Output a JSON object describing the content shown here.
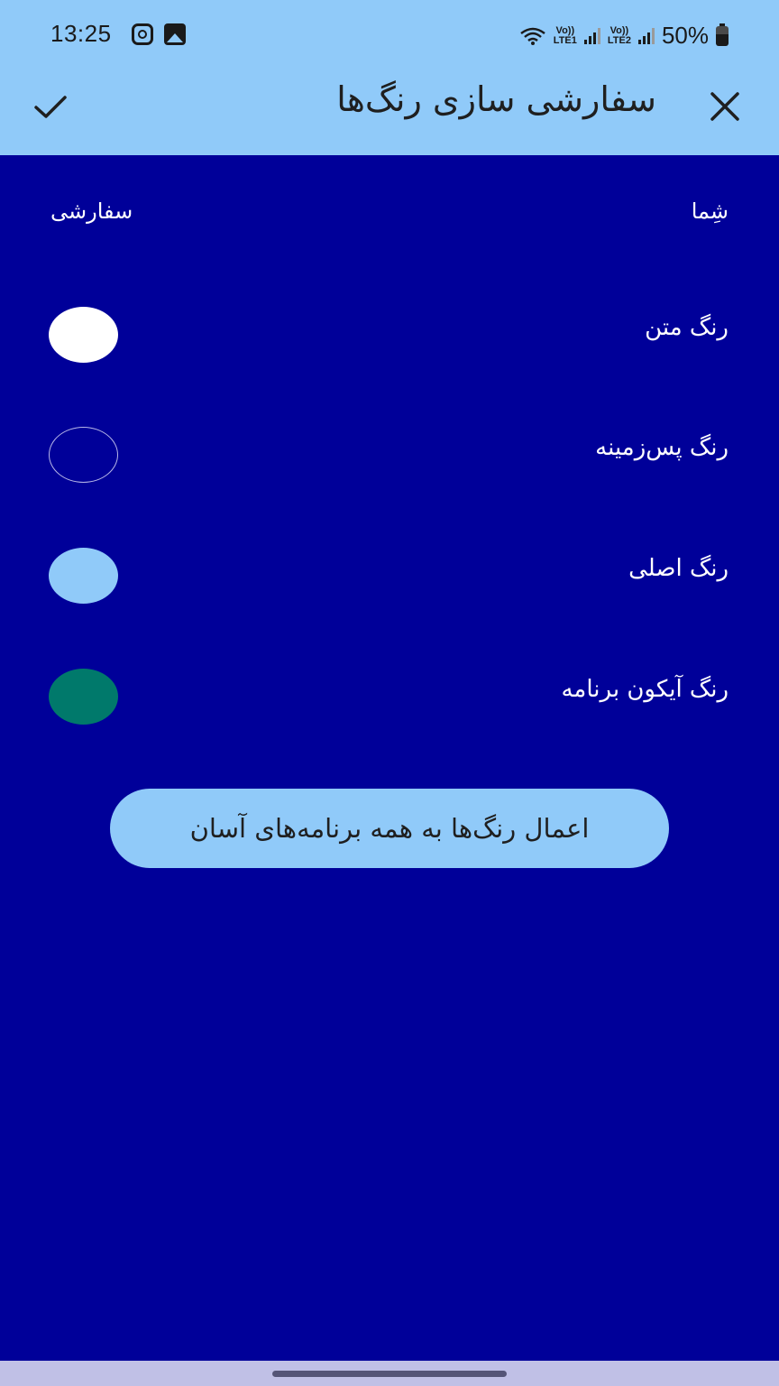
{
  "status_bar": {
    "time": "13:25",
    "left_icons": [
      "instagram-icon",
      "gallery-icon"
    ],
    "sim1_label_top": "Vo))",
    "sim1_label_bottom": "LTE1",
    "sim2_label_top": "Vo))",
    "sim2_label_bottom": "LTE2",
    "battery": "50%"
  },
  "toolbar": {
    "title": "سفارشی سازی رنگ‌ها",
    "confirm_icon": "check-icon",
    "close_icon": "close-icon"
  },
  "columns": {
    "you": "شِما",
    "custom": "سفارشی"
  },
  "color_rows": [
    {
      "label": "رنگ متن",
      "color": "#ffffff",
      "outlined": false
    },
    {
      "label": "رنگ پس‌زمینه",
      "color": "#000099",
      "outlined": true
    },
    {
      "label": "رنگ اصلی",
      "color": "#90caf9",
      "outlined": false
    },
    {
      "label": "رنگ آیکون برنامه",
      "color": "#00796b",
      "outlined": false
    }
  ],
  "apply_button": "اعمال رنگ‌ها به همه برنامه‌های آسان",
  "colors": {
    "background": "#000099",
    "appbar": "#90caf9",
    "nav_bar": "#c0c0e6"
  }
}
